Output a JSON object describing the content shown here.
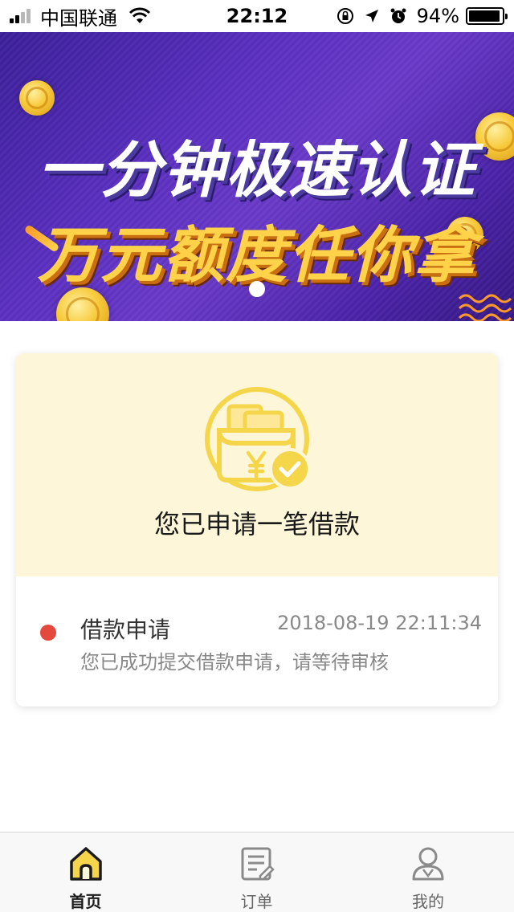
{
  "status_bar": {
    "carrier": "中国联通",
    "time": "22:12",
    "battery_percent": "94%",
    "battery_level": 0.94,
    "icons": [
      "signal-icon",
      "wifi-icon",
      "orientation-lock-icon",
      "location-arrow-icon",
      "alarm-icon",
      "battery-icon"
    ]
  },
  "banner": {
    "line1": "一分钟极速认证",
    "line2": "万元额度任你拿",
    "slide_index": 1,
    "slide_count": 1
  },
  "application_card": {
    "icon": "wallet-yuan-check-icon",
    "title": "您已申请一笔借款",
    "accent_color": "#f5d54a",
    "timeline": [
      {
        "title": "借款申请",
        "time": "2018-08-19 22:11:34",
        "description": "您已成功提交借款申请，请等待审核",
        "status_color": "#e5483c"
      }
    ]
  },
  "tab_bar": {
    "tabs": [
      {
        "label": "首页",
        "icon": "home-icon",
        "active": true
      },
      {
        "label": "订单",
        "icon": "order-icon",
        "active": false
      },
      {
        "label": "我的",
        "icon": "profile-icon",
        "active": false
      }
    ],
    "active_color": "#f5d54a"
  }
}
